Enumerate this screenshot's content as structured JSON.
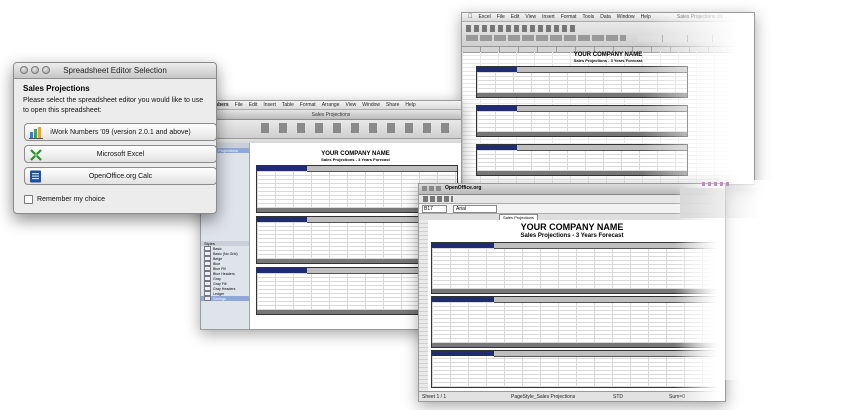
{
  "dialog": {
    "title": "Spreadsheet Editor Selection",
    "heading": "Sales Projections",
    "message": "Please select the spreadsheet editor you would like to use to open this spreadsheet:",
    "options": [
      {
        "label": "iWork Numbers '09 (version 2.0.1 and above)",
        "icon": "numbers-icon"
      },
      {
        "label": "Microsoft Excel",
        "icon": "excel-icon"
      },
      {
        "label": "OpenOffice.org Calc",
        "icon": "openoffice-icon"
      }
    ],
    "remember_label": "Remember my choice"
  },
  "numbers_window": {
    "menu": [
      "Numbers",
      "File",
      "Edit",
      "Insert",
      "Table",
      "Format",
      "Arrange",
      "View",
      "Window",
      "Share",
      "Help"
    ],
    "title": "Sales Projections",
    "doc_title": "YOUR COMPANY NAME",
    "doc_subtitle": "Sales Projections - 3 Years Forecast",
    "sidebar_sheets_header": "Sheets",
    "sidebar_sheet": "Sales Projections",
    "styles_header": "Styles",
    "styles": [
      "Basic",
      "Basic (No Grid)",
      "Beige",
      "Blue",
      "Blue Fill",
      "Blue Headers",
      "Gray",
      "Gray Fill",
      "Gray Headers",
      "Ledger",
      "Savings"
    ]
  },
  "excel_window": {
    "menu": [
      "Excel",
      "File",
      "Edit",
      "View",
      "Insert",
      "Format",
      "Tools",
      "Data",
      "Window",
      "Help"
    ],
    "title": "Sales Projections.xls",
    "doc_title": "YOUR COMPANY NAME",
    "doc_subtitle": "Sales Projections - 3 Years Forecast"
  },
  "openoffice_window": {
    "app_label": "OpenOffice.org",
    "cell_ref": "B17",
    "font_name": "Arial",
    "doc_title": "YOUR COMPANY NAME",
    "doc_subtitle": "Sales Projections - 3 Years Forecast",
    "sheet_tab": "Sales Projections",
    "status": {
      "sheet": "Sheet 1 / 1",
      "page_style": "PageStyle_Sales Projections",
      "mode": "STD",
      "sum": "Sum=0"
    }
  },
  "colors": {
    "header_navy": "#1f2b73",
    "dialog_bg": "#ececec",
    "selection_blue": "#8fa8d8"
  }
}
